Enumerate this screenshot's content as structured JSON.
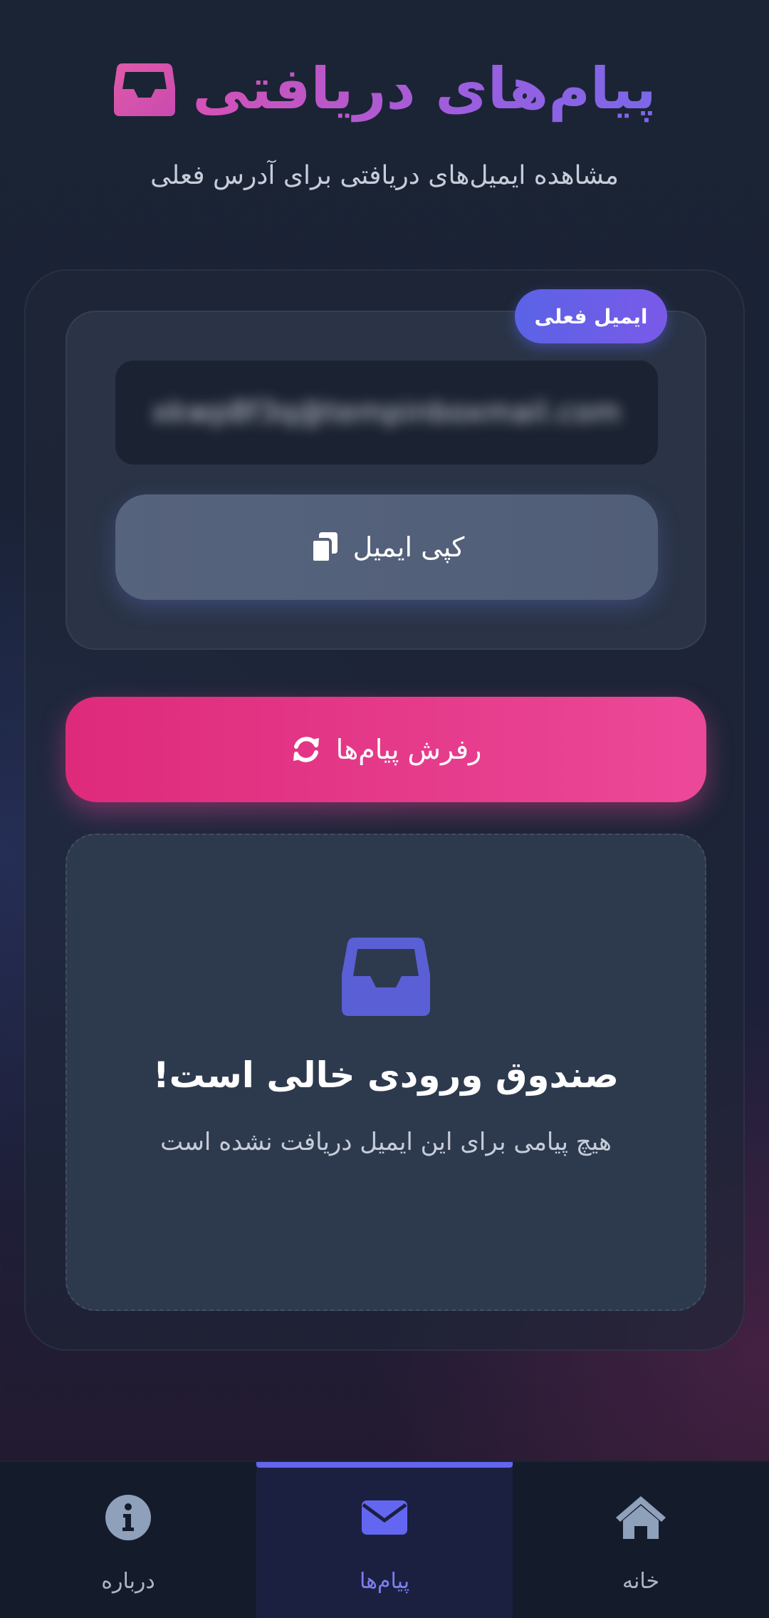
{
  "header": {
    "title": "پیام‌های دریافتی",
    "subtitle": "مشاهده ایمیل‌های دریافتی برای آدرس فعلی",
    "icon": "inbox-icon"
  },
  "email_card": {
    "badge": "ایمیل فعلی",
    "email_value": "xkwp8f3q@tempinboxmail.com",
    "copy_label": "کپی ایمیل",
    "copy_icon": "copy-icon"
  },
  "actions": {
    "refresh_label": "رفرش پیام‌ها",
    "refresh_icon": "refresh-icon"
  },
  "empty_state": {
    "icon": "inbox-icon",
    "title": "صندوق ورودی خالی است!",
    "description": "هیچ پیامی برای این ایمیل دریافت نشده است"
  },
  "nav": {
    "items": [
      {
        "label": "خانه",
        "icon": "home-icon",
        "active": false
      },
      {
        "label": "پیام‌ها",
        "icon": "envelope-icon",
        "active": true
      },
      {
        "label": "درباره",
        "icon": "info-icon",
        "active": false
      }
    ]
  },
  "colors": {
    "accent": "#6366f1",
    "pink": "#ec4899",
    "background": "#1b2434",
    "card": "#2a3446"
  }
}
